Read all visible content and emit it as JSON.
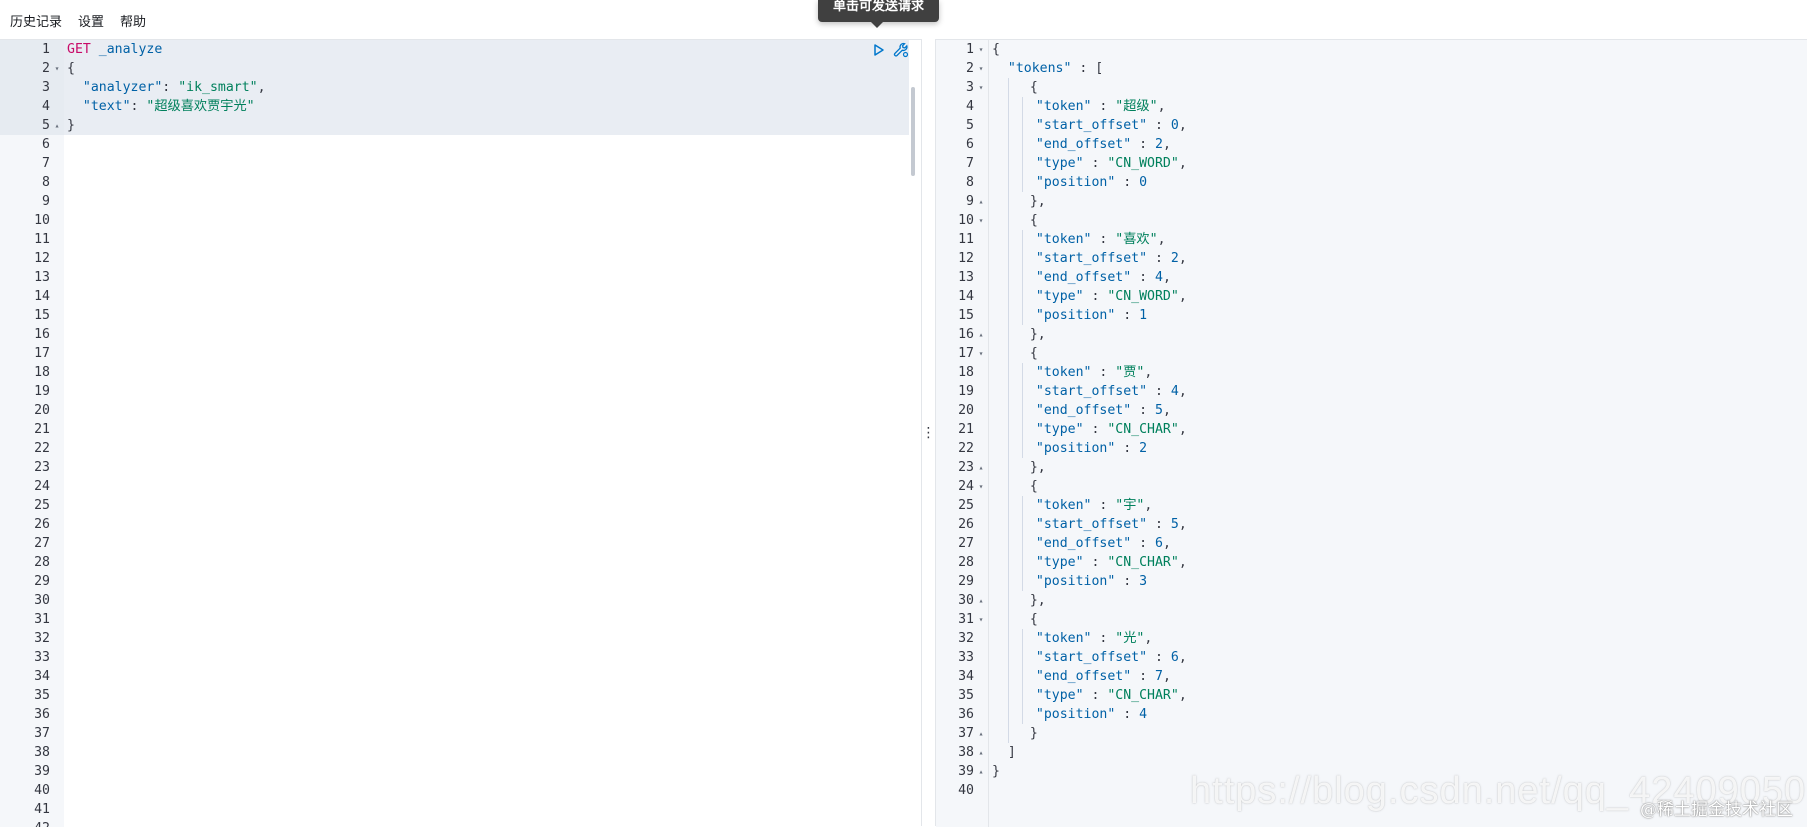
{
  "menu": {
    "items": [
      "历史记录",
      "设置",
      "帮助"
    ]
  },
  "tooltip": {
    "text": "单击可发送请求"
  },
  "request_editor": {
    "lines": [
      [
        {
          "t": "method",
          "v": "GET"
        },
        {
          "t": "plain",
          "v": " "
        },
        {
          "t": "url",
          "v": "_analyze"
        }
      ],
      [
        {
          "t": "punc",
          "v": "{"
        }
      ],
      [
        {
          "t": "plain",
          "v": "  "
        },
        {
          "t": "key",
          "v": "\"analyzer\""
        },
        {
          "t": "punc",
          "v": ": "
        },
        {
          "t": "str",
          "v": "\"ik_smart\""
        },
        {
          "t": "punc",
          "v": ","
        }
      ],
      [
        {
          "t": "plain",
          "v": "  "
        },
        {
          "t": "key",
          "v": "\"text\""
        },
        {
          "t": "punc",
          "v": ": "
        },
        {
          "t": "str",
          "v": "\"超级喜欢贾宇光\""
        }
      ],
      [
        {
          "t": "punc",
          "v": "}"
        }
      ]
    ],
    "line_count": 43,
    "fold_markers": {
      "2": "▾",
      "5": "▴"
    }
  },
  "response_editor": {
    "line_count": 40,
    "fold_markers": {
      "1": "▾",
      "2": "▾",
      "3": "▾",
      "9": "▴",
      "10": "▾",
      "16": "▴",
      "17": "▾",
      "23": "▴",
      "24": "▾",
      "30": "▴",
      "31": "▾",
      "37": "▴",
      "38": "▴",
      "39": "▴"
    },
    "tokens": [
      {
        "token": "超级",
        "start_offset": "0",
        "end_offset": "2",
        "type": "CN_WORD",
        "position": "0"
      },
      {
        "token": "喜欢",
        "start_offset": "2",
        "end_offset": "4",
        "type": "CN_WORD",
        "position": "1"
      },
      {
        "token": "贾",
        "start_offset": "4",
        "end_offset": "5",
        "type": "CN_CHAR",
        "position": "2"
      },
      {
        "token": "宇",
        "start_offset": "5",
        "end_offset": "6",
        "type": "CN_CHAR",
        "position": "3"
      },
      {
        "token": "光",
        "start_offset": "6",
        "end_offset": "7",
        "type": "CN_CHAR",
        "position": "4"
      }
    ],
    "keys": {
      "tokens": "\"tokens\"",
      "token": "\"token\"",
      "start_offset": "\"start_offset\"",
      "end_offset": "\"end_offset\"",
      "type": "\"type\"",
      "position": "\"position\""
    }
  },
  "icons": {
    "send": "play-triangle-icon",
    "settings": "wrench-icon",
    "resizer": "vertical-ellipsis-icon"
  },
  "watermark": {
    "url": "https://blog.csdn.net/qq_42409050",
    "community": "@稀土掘金技术社区"
  },
  "colors": {
    "method": "#c80a68",
    "key": "#0061a6",
    "string": "#00805c",
    "gutter": "#f5f7fa",
    "tooltip_bg": "#404040"
  }
}
